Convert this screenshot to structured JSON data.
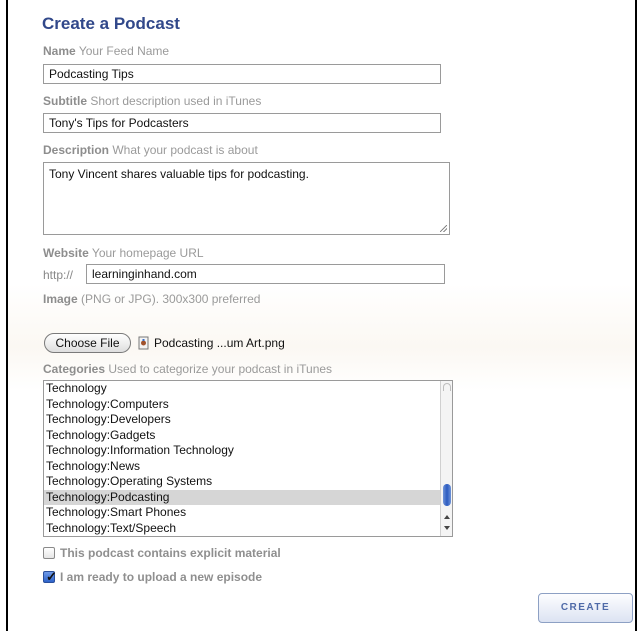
{
  "page": {
    "title": "Create a Podcast"
  },
  "name": {
    "label": "Name",
    "hint": "Your Feed Name",
    "value": "Podcasting Tips"
  },
  "subtitle": {
    "label": "Subtitle",
    "hint": "Short description used in iTunes",
    "value": "Tony's Tips for Podcasters"
  },
  "description": {
    "label": "Description",
    "hint": "What your podcast is about",
    "value": "Tony Vincent shares valuable tips for podcasting."
  },
  "website": {
    "label": "Website",
    "hint": "Your homepage URL",
    "prefix": "http://",
    "value": "learninginhand.com"
  },
  "image": {
    "label": "Image",
    "hint": "(PNG or JPG). 300x300 preferred",
    "button": "Choose File",
    "filename": "Podcasting ...um Art.png",
    "file_icon": "file-icon"
  },
  "categories": {
    "label": "Categories",
    "hint": "Used to categorize your podcast in iTunes",
    "items": [
      "Technology",
      "Technology:Computers",
      "Technology:Developers",
      "Technology:Gadgets",
      "Technology:Information Technology",
      "Technology:News",
      "Technology:Operating Systems",
      "Technology:Podcasting",
      "Technology:Smart Phones",
      "Technology:Text/Speech"
    ],
    "selected": "Technology:Podcasting"
  },
  "checkboxes": {
    "explicit": {
      "label": "This podcast contains explicit material",
      "checked": false
    },
    "ready": {
      "label": "I am ready to upload a new episode",
      "checked": true
    }
  },
  "actions": {
    "create": "CREATE"
  },
  "colors": {
    "title": "#31488a",
    "button_text": "#4f6aa8",
    "scroll_thumb": "#2b5bc0"
  }
}
